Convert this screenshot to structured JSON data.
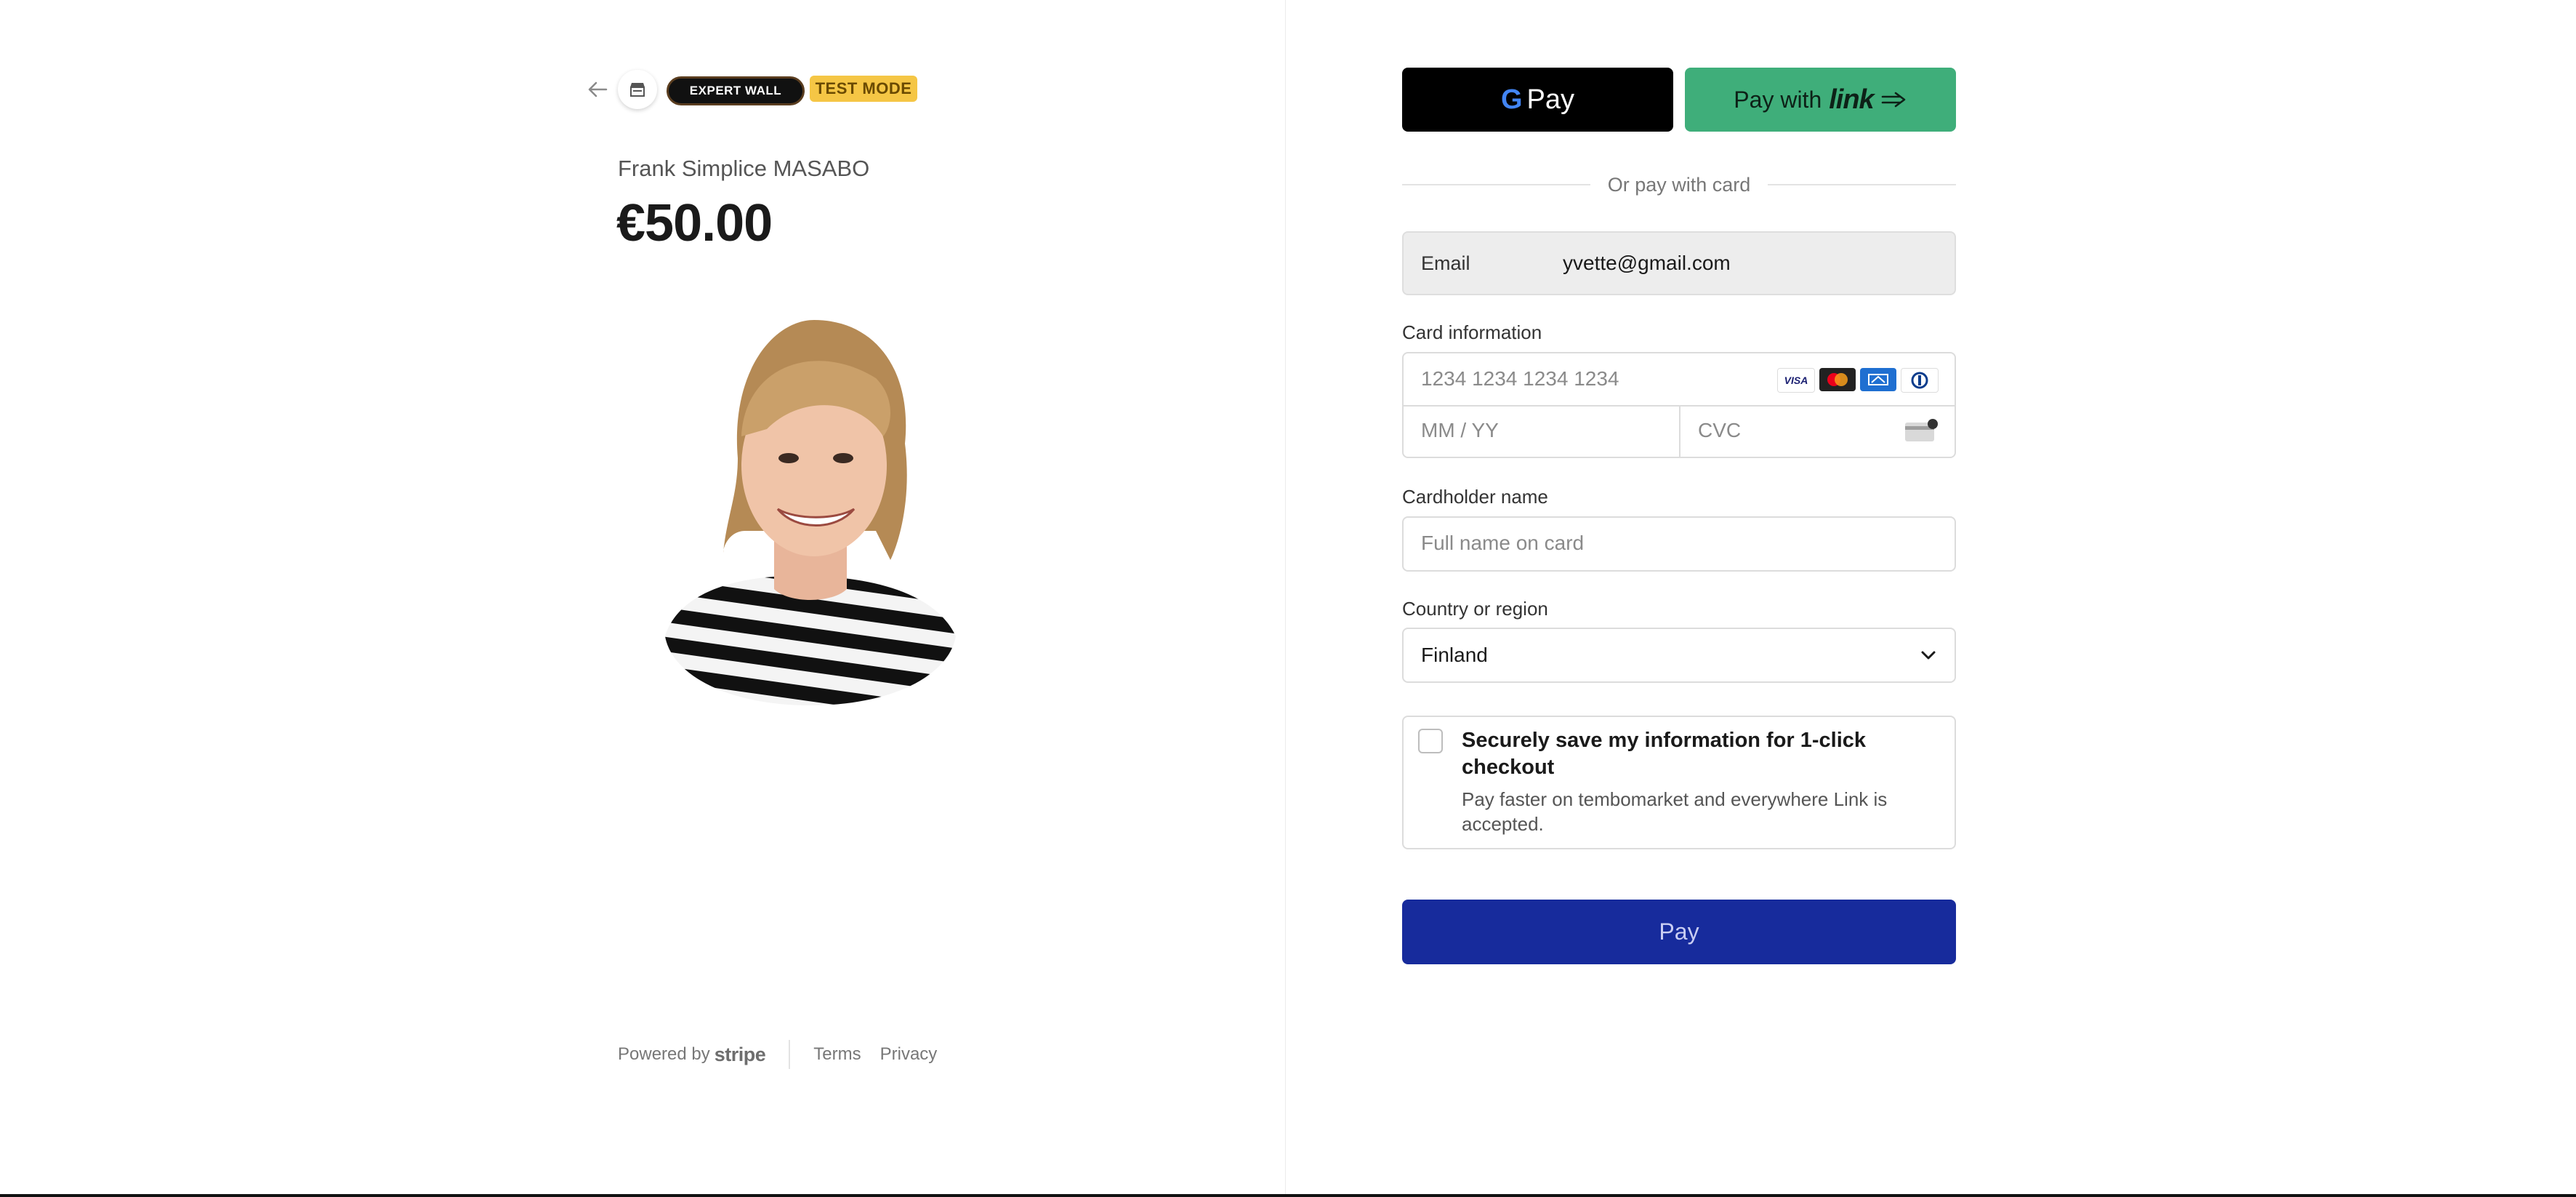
{
  "header": {
    "brand": "EXPERT WALL",
    "test_mode": "TEST MODE"
  },
  "product": {
    "merchant": "Frank Simplice MASABO",
    "amount": "€50.00"
  },
  "footer": {
    "powered_by": "Powered by",
    "stripe": "stripe",
    "terms": "Terms",
    "privacy": "Privacy"
  },
  "wallets": {
    "gpay_g": "G",
    "gpay_label": "Pay",
    "link_prefix": "Pay with",
    "link_word": "link"
  },
  "divider_text": "Or pay with card",
  "email": {
    "label": "Email",
    "value": "yvette@gmail.com"
  },
  "card": {
    "label": "Card information",
    "number_placeholder": "1234 1234 1234 1234",
    "expiry_placeholder": "MM / YY",
    "cvc_placeholder": "CVC",
    "brand_visa": "VISA"
  },
  "cardholder": {
    "label": "Cardholder name",
    "placeholder": "Full name on card"
  },
  "country": {
    "label": "Country or region",
    "value": "Finland"
  },
  "save": {
    "title": "Securely save my information for 1-click checkout",
    "subtitle": "Pay faster on tembomarket and everywhere Link is accepted."
  },
  "pay_button": "Pay",
  "colors": {
    "pay_button": "#172b9c",
    "link_button": "#3fae7a",
    "test_badge": "#f5c645"
  }
}
